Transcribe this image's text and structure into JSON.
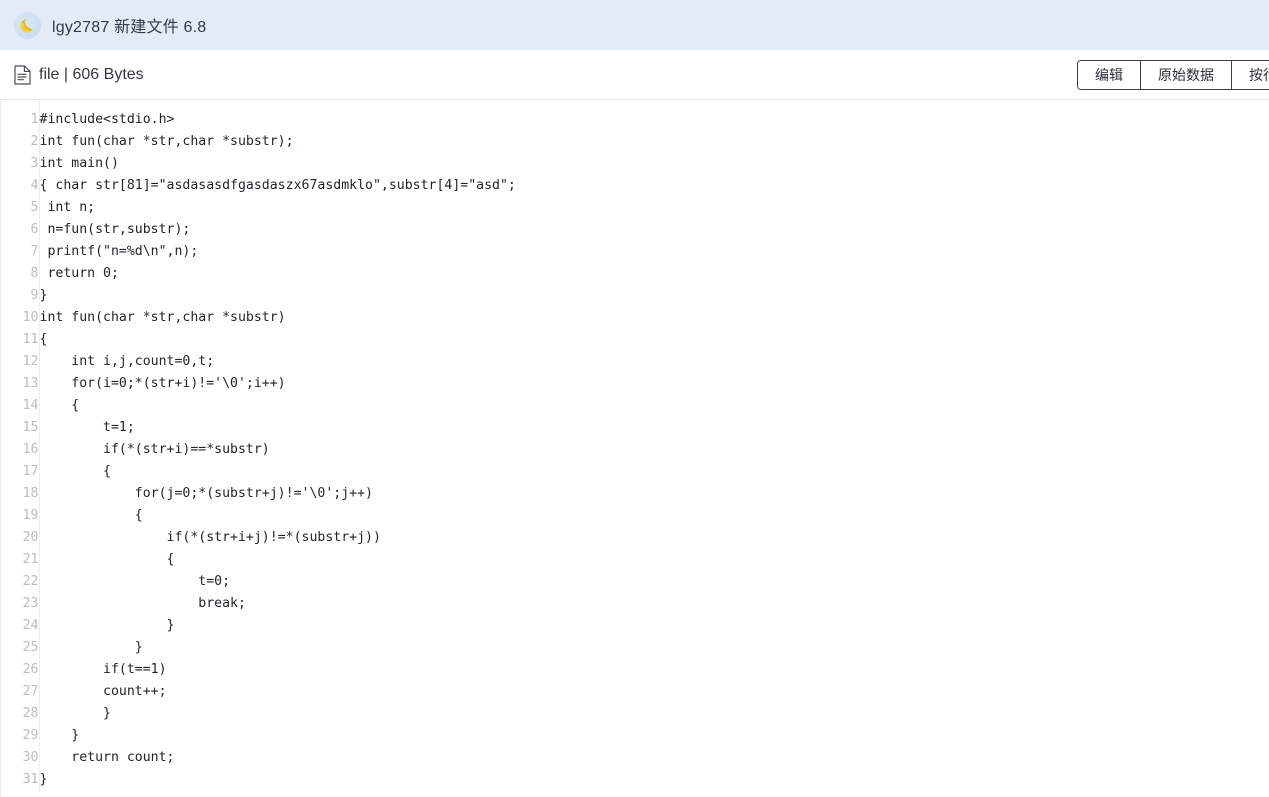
{
  "app_bar": {
    "logo_icon": "banana-moon-logo-icon",
    "title": "lgy2787 新建文件 6.8"
  },
  "file_header": {
    "file_icon": "document-icon",
    "file_label": "file",
    "separator": "|",
    "file_size": "606 Bytes",
    "meta_text": "file | 606 Bytes",
    "buttons": [
      {
        "name": "edit-button",
        "label": "编辑"
      },
      {
        "name": "raw-data-button",
        "label": "原始数据"
      },
      {
        "name": "by-line-button",
        "label": "按行"
      }
    ]
  },
  "code_viewer": {
    "language": "c",
    "line_count": 31,
    "gutter_color": "#b9bdc2",
    "text_color": "#1f2328",
    "lines": [
      {
        "n": "1",
        "text": "#include<stdio.h>"
      },
      {
        "n": "2",
        "text": "int fun(char *str,char *substr);"
      },
      {
        "n": "3",
        "text": "int main()"
      },
      {
        "n": "4",
        "text": "{ char str[81]=\"asdasasdfgasdaszx67asdmklo\",substr[4]=\"asd\";"
      },
      {
        "n": "5",
        "text": " int n;"
      },
      {
        "n": "6",
        "text": " n=fun(str,substr);"
      },
      {
        "n": "7",
        "text": " printf(\"n=%d\\n\",n);"
      },
      {
        "n": "8",
        "text": " return 0;"
      },
      {
        "n": "9",
        "text": "}"
      },
      {
        "n": "10",
        "text": "int fun(char *str,char *substr)"
      },
      {
        "n": "11",
        "text": "{"
      },
      {
        "n": "12",
        "text": "    int i,j,count=0,t;"
      },
      {
        "n": "13",
        "text": "    for(i=0;*(str+i)!='\\0';i++)"
      },
      {
        "n": "14",
        "text": "    {"
      },
      {
        "n": "15",
        "text": "        t=1;"
      },
      {
        "n": "16",
        "text": "        if(*(str+i)==*substr)"
      },
      {
        "n": "17",
        "text": "        {"
      },
      {
        "n": "18",
        "text": "            for(j=0;*(substr+j)!='\\0';j++)"
      },
      {
        "n": "19",
        "text": "            {"
      },
      {
        "n": "20",
        "text": "                if(*(str+i+j)!=*(substr+j))"
      },
      {
        "n": "21",
        "text": "                {"
      },
      {
        "n": "22",
        "text": "                    t=0;"
      },
      {
        "n": "23",
        "text": "                    break;"
      },
      {
        "n": "24",
        "text": "                }"
      },
      {
        "n": "25",
        "text": "            }"
      },
      {
        "n": "26",
        "text": "        if(t==1)"
      },
      {
        "n": "27",
        "text": "        count++;"
      },
      {
        "n": "28",
        "text": "        }"
      },
      {
        "n": "29",
        "text": "    }"
      },
      {
        "n": "30",
        "text": "    return count;"
      },
      {
        "n": "31",
        "text": "}"
      }
    ]
  },
  "colors": {
    "app_bar_bg": "#e3ecf6",
    "page_bg": "#ffffff",
    "border": "#e6e6e6",
    "button_border": "#3c3f44"
  }
}
